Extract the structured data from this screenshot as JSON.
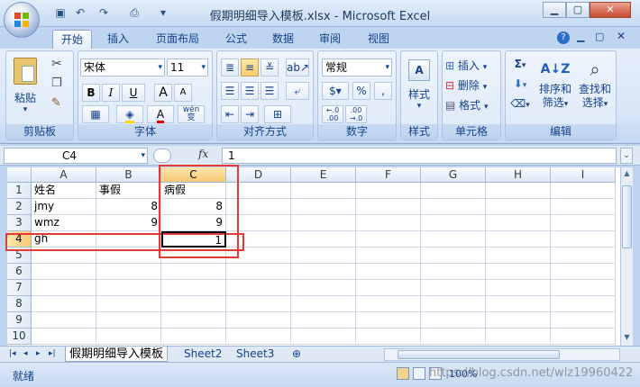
{
  "window": {
    "title": "假期明细导入模板.xlsx - Microsoft Excel"
  },
  "tabs": [
    "开始",
    "插入",
    "页面布局",
    "公式",
    "数据",
    "审阅",
    "视图"
  ],
  "ribbon": {
    "clipboard": {
      "label": "剪贴板",
      "paste": "粘贴"
    },
    "font": {
      "label": "字体",
      "name": "宋体",
      "size": "11",
      "bold": "B",
      "italic": "I",
      "underline": "U",
      "grow": "A",
      "shrink": "A",
      "color_letter": "A",
      "phonetic": "wén"
    },
    "alignment": {
      "label": "对齐方式"
    },
    "number": {
      "label": "数字",
      "format": "常规",
      "percent": "%",
      "comma": ",",
      "inc": ".0 .00",
      "dec": ".00 .0"
    },
    "styles": {
      "label": "样式",
      "button": "样式"
    },
    "cells": {
      "label": "单元格",
      "insert": "插入",
      "delete": "删除",
      "format": "格式"
    },
    "editing": {
      "label": "编辑",
      "sum": "Σ",
      "sort": "排序和\n筛选",
      "find": "查找和\n选择",
      "sort_line1": "排序和",
      "sort_line2": "筛选",
      "find_line1": "查找和",
      "find_line2": "选择"
    }
  },
  "formula_bar": {
    "name_box": "C4",
    "fx": "fx",
    "value": "1"
  },
  "columns": [
    "A",
    "B",
    "C",
    "D",
    "E",
    "F",
    "G",
    "H",
    "I"
  ],
  "rows": [
    "1",
    "2",
    "3",
    "4",
    "5",
    "6",
    "7",
    "8",
    "9",
    "10"
  ],
  "cells": {
    "A1": "姓名",
    "B1": "事假",
    "C1": "病假",
    "A2": "jmy",
    "B2": "8",
    "C2": "8",
    "A3": "wmz",
    "B3": "9",
    "C3": "9",
    "A4": "gh",
    "C4": "1"
  },
  "sheets": [
    "假期明细导入模板",
    "Sheet2",
    "Sheet3"
  ],
  "status": {
    "text": "就绪",
    "zoom": "100%",
    "watermark": "https://blog.csdn.net/wlz19960422"
  },
  "colors": {
    "highlight": "#e53935",
    "header_selected": "#f7c872"
  }
}
